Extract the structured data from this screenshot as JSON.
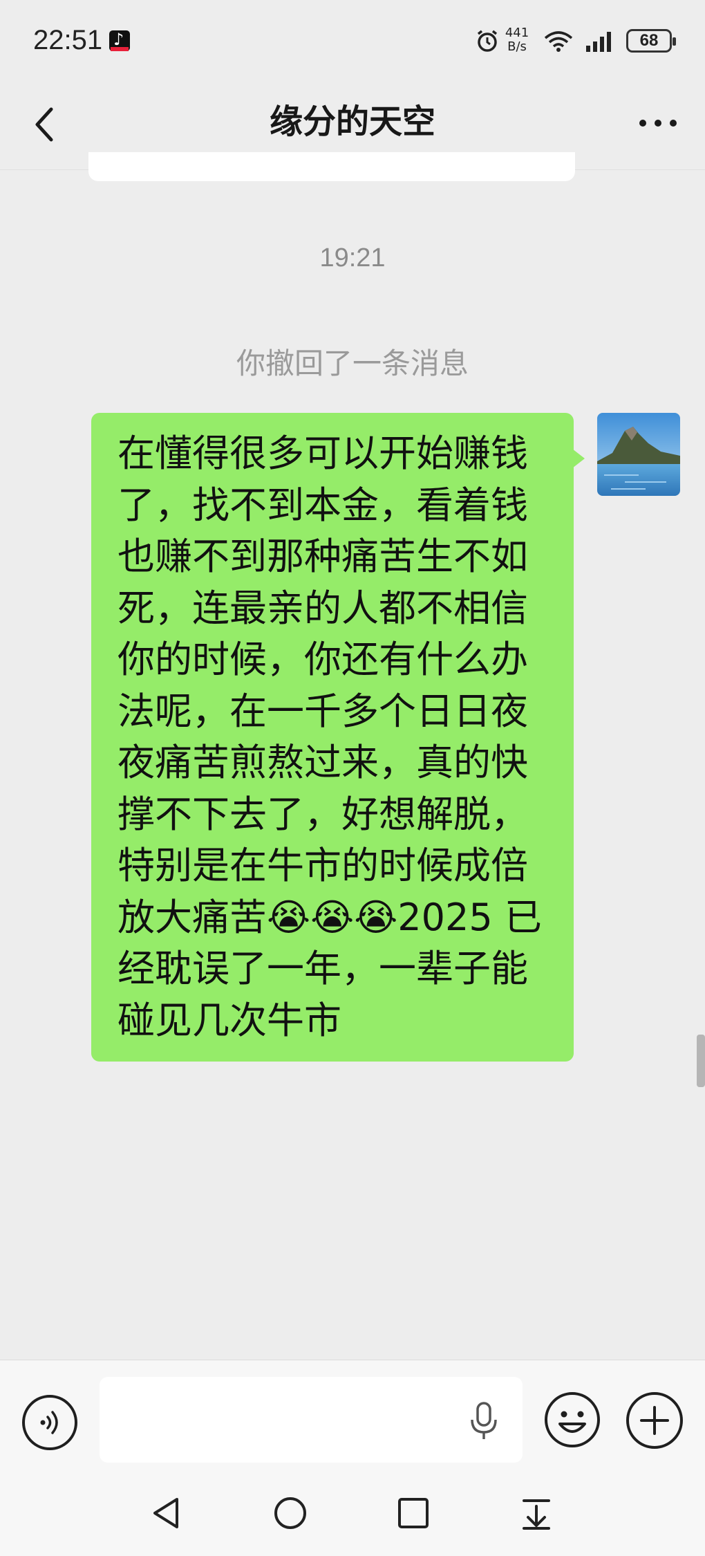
{
  "status_bar": {
    "time": "22:51",
    "net_speed_value": "441",
    "net_speed_unit": "B/s",
    "battery": "68"
  },
  "header": {
    "title": "缘分的天空"
  },
  "chat": {
    "timestamp": "19:21",
    "recall_notice": "你撤回了一条消息",
    "messages": [
      {
        "sender": "me",
        "text": "在懂得很多可以开始赚钱了，找不到本金，看着钱也赚不到那种痛苦生不如死，连最亲的人都不相信你的时候，你还有什么办法呢，在一千多个日日夜夜痛苦煎熬过来，真的快撑不下去了，好想解脱，特别是在牛市的时候成倍放大痛苦😭😭😭2025 已经耽误了一年，一辈子能碰见几次牛市"
      }
    ]
  },
  "input": {
    "value": ""
  },
  "icons": {
    "back": "back-arrow-icon",
    "more": "more-dots-icon",
    "voice": "voice-icon",
    "mic": "mic-icon",
    "emoji": "emoji-icon",
    "plus": "plus-icon"
  },
  "colors": {
    "background": "#ededed",
    "my_bubble": "#95ec69",
    "secondary_text": "#9a9a9a"
  }
}
